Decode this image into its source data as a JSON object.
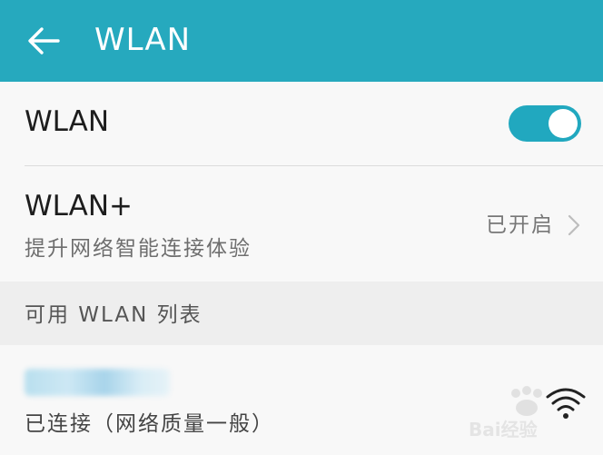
{
  "app_bar": {
    "title": "WLAN",
    "back_icon": "arrow-left-icon",
    "background_color": "#26a9be"
  },
  "wlan_row": {
    "label": "WLAN",
    "toggle_on": true,
    "toggle_color": "#21a8bf"
  },
  "wlan_plus_row": {
    "label": "WLAN+",
    "subtitle": "提升网络智能连接体验",
    "status": "已开启",
    "chevron_icon": "chevron-right-icon"
  },
  "available_section": {
    "header": "可用 WLAN 列表"
  },
  "networks": [
    {
      "ssid_visible": false,
      "status": "已连接（网络质量一般）",
      "signal_icon": "wifi-signal-icon"
    }
  ],
  "watermark": {
    "text": "Bai经验"
  }
}
